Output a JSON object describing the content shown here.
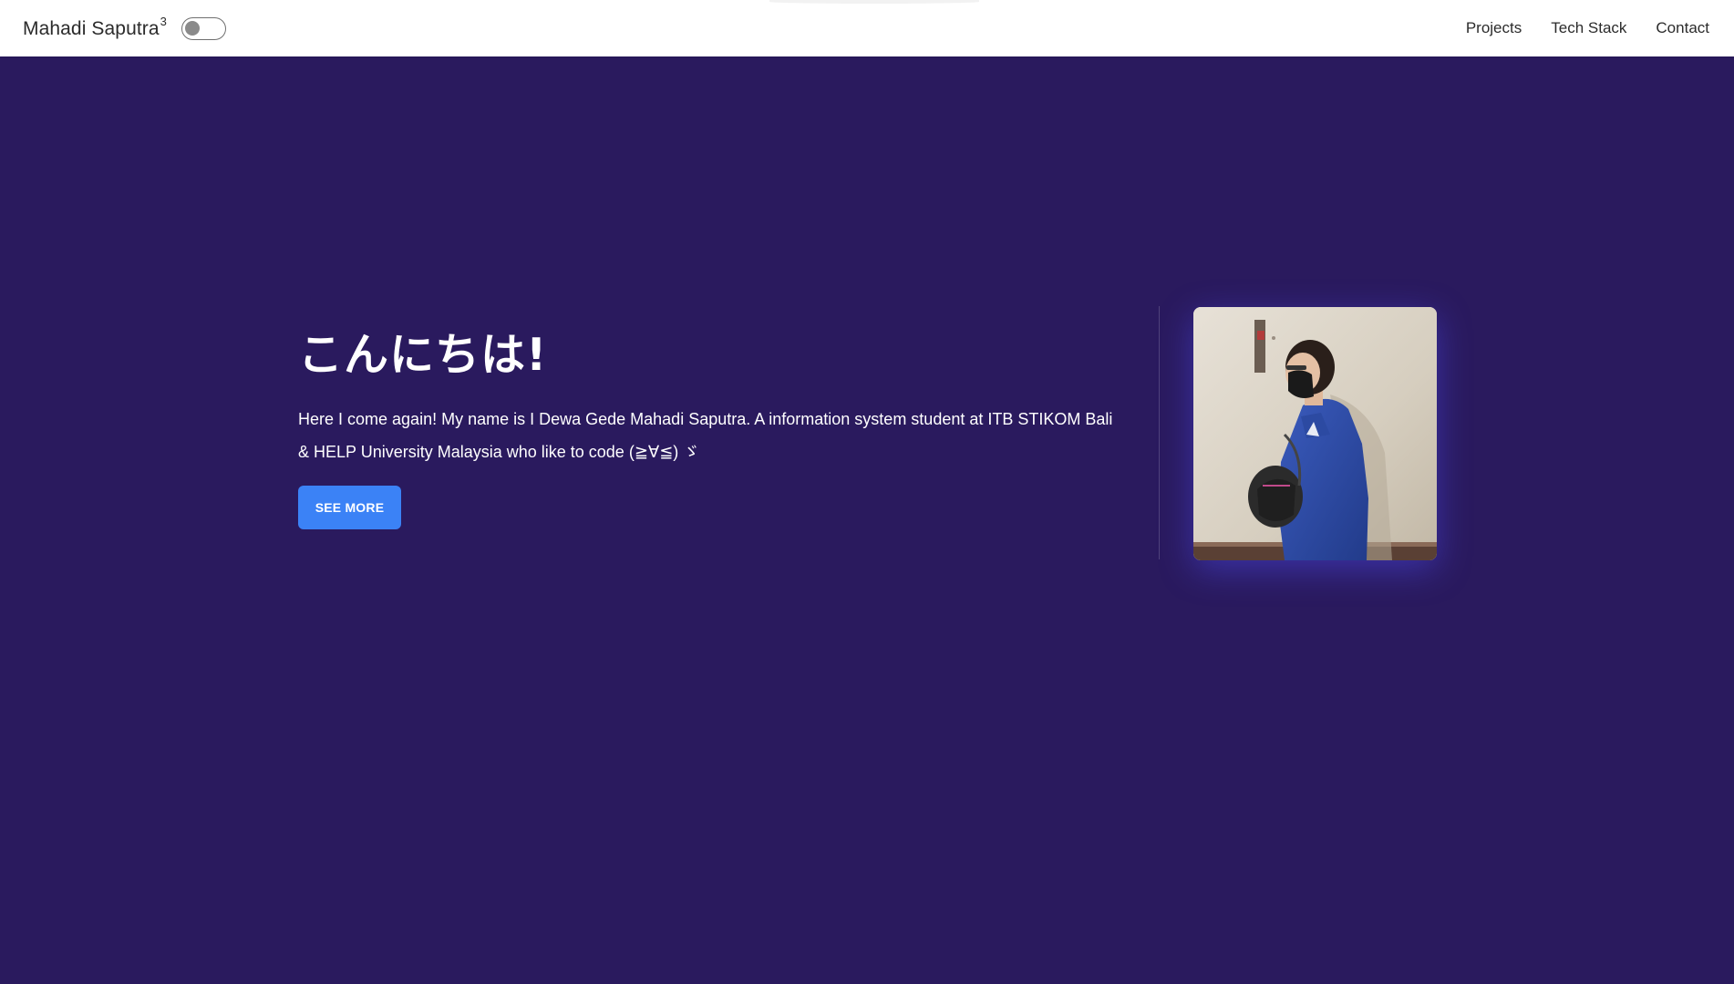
{
  "navbar": {
    "brand": "Mahadi Saputra",
    "brand_sup": "3",
    "links": [
      {
        "label": "Projects"
      },
      {
        "label": "Tech Stack"
      },
      {
        "label": "Contact"
      }
    ]
  },
  "theme_toggle": {
    "state": "off"
  },
  "hero": {
    "greeting": "こんにちは!",
    "intro": "Here I come again! My name is I Dewa Gede Mahadi Saputra. A information system student at ITB STIKOM Bali & HELP University Malaysia who like to code (≧∀≦) ゞ",
    "cta_label": "SEE MORE",
    "photo_alt": "Profile photo"
  },
  "colors": {
    "background": "#2a1a5e",
    "navbar": "#ffffff",
    "button": "#3b82f6"
  }
}
